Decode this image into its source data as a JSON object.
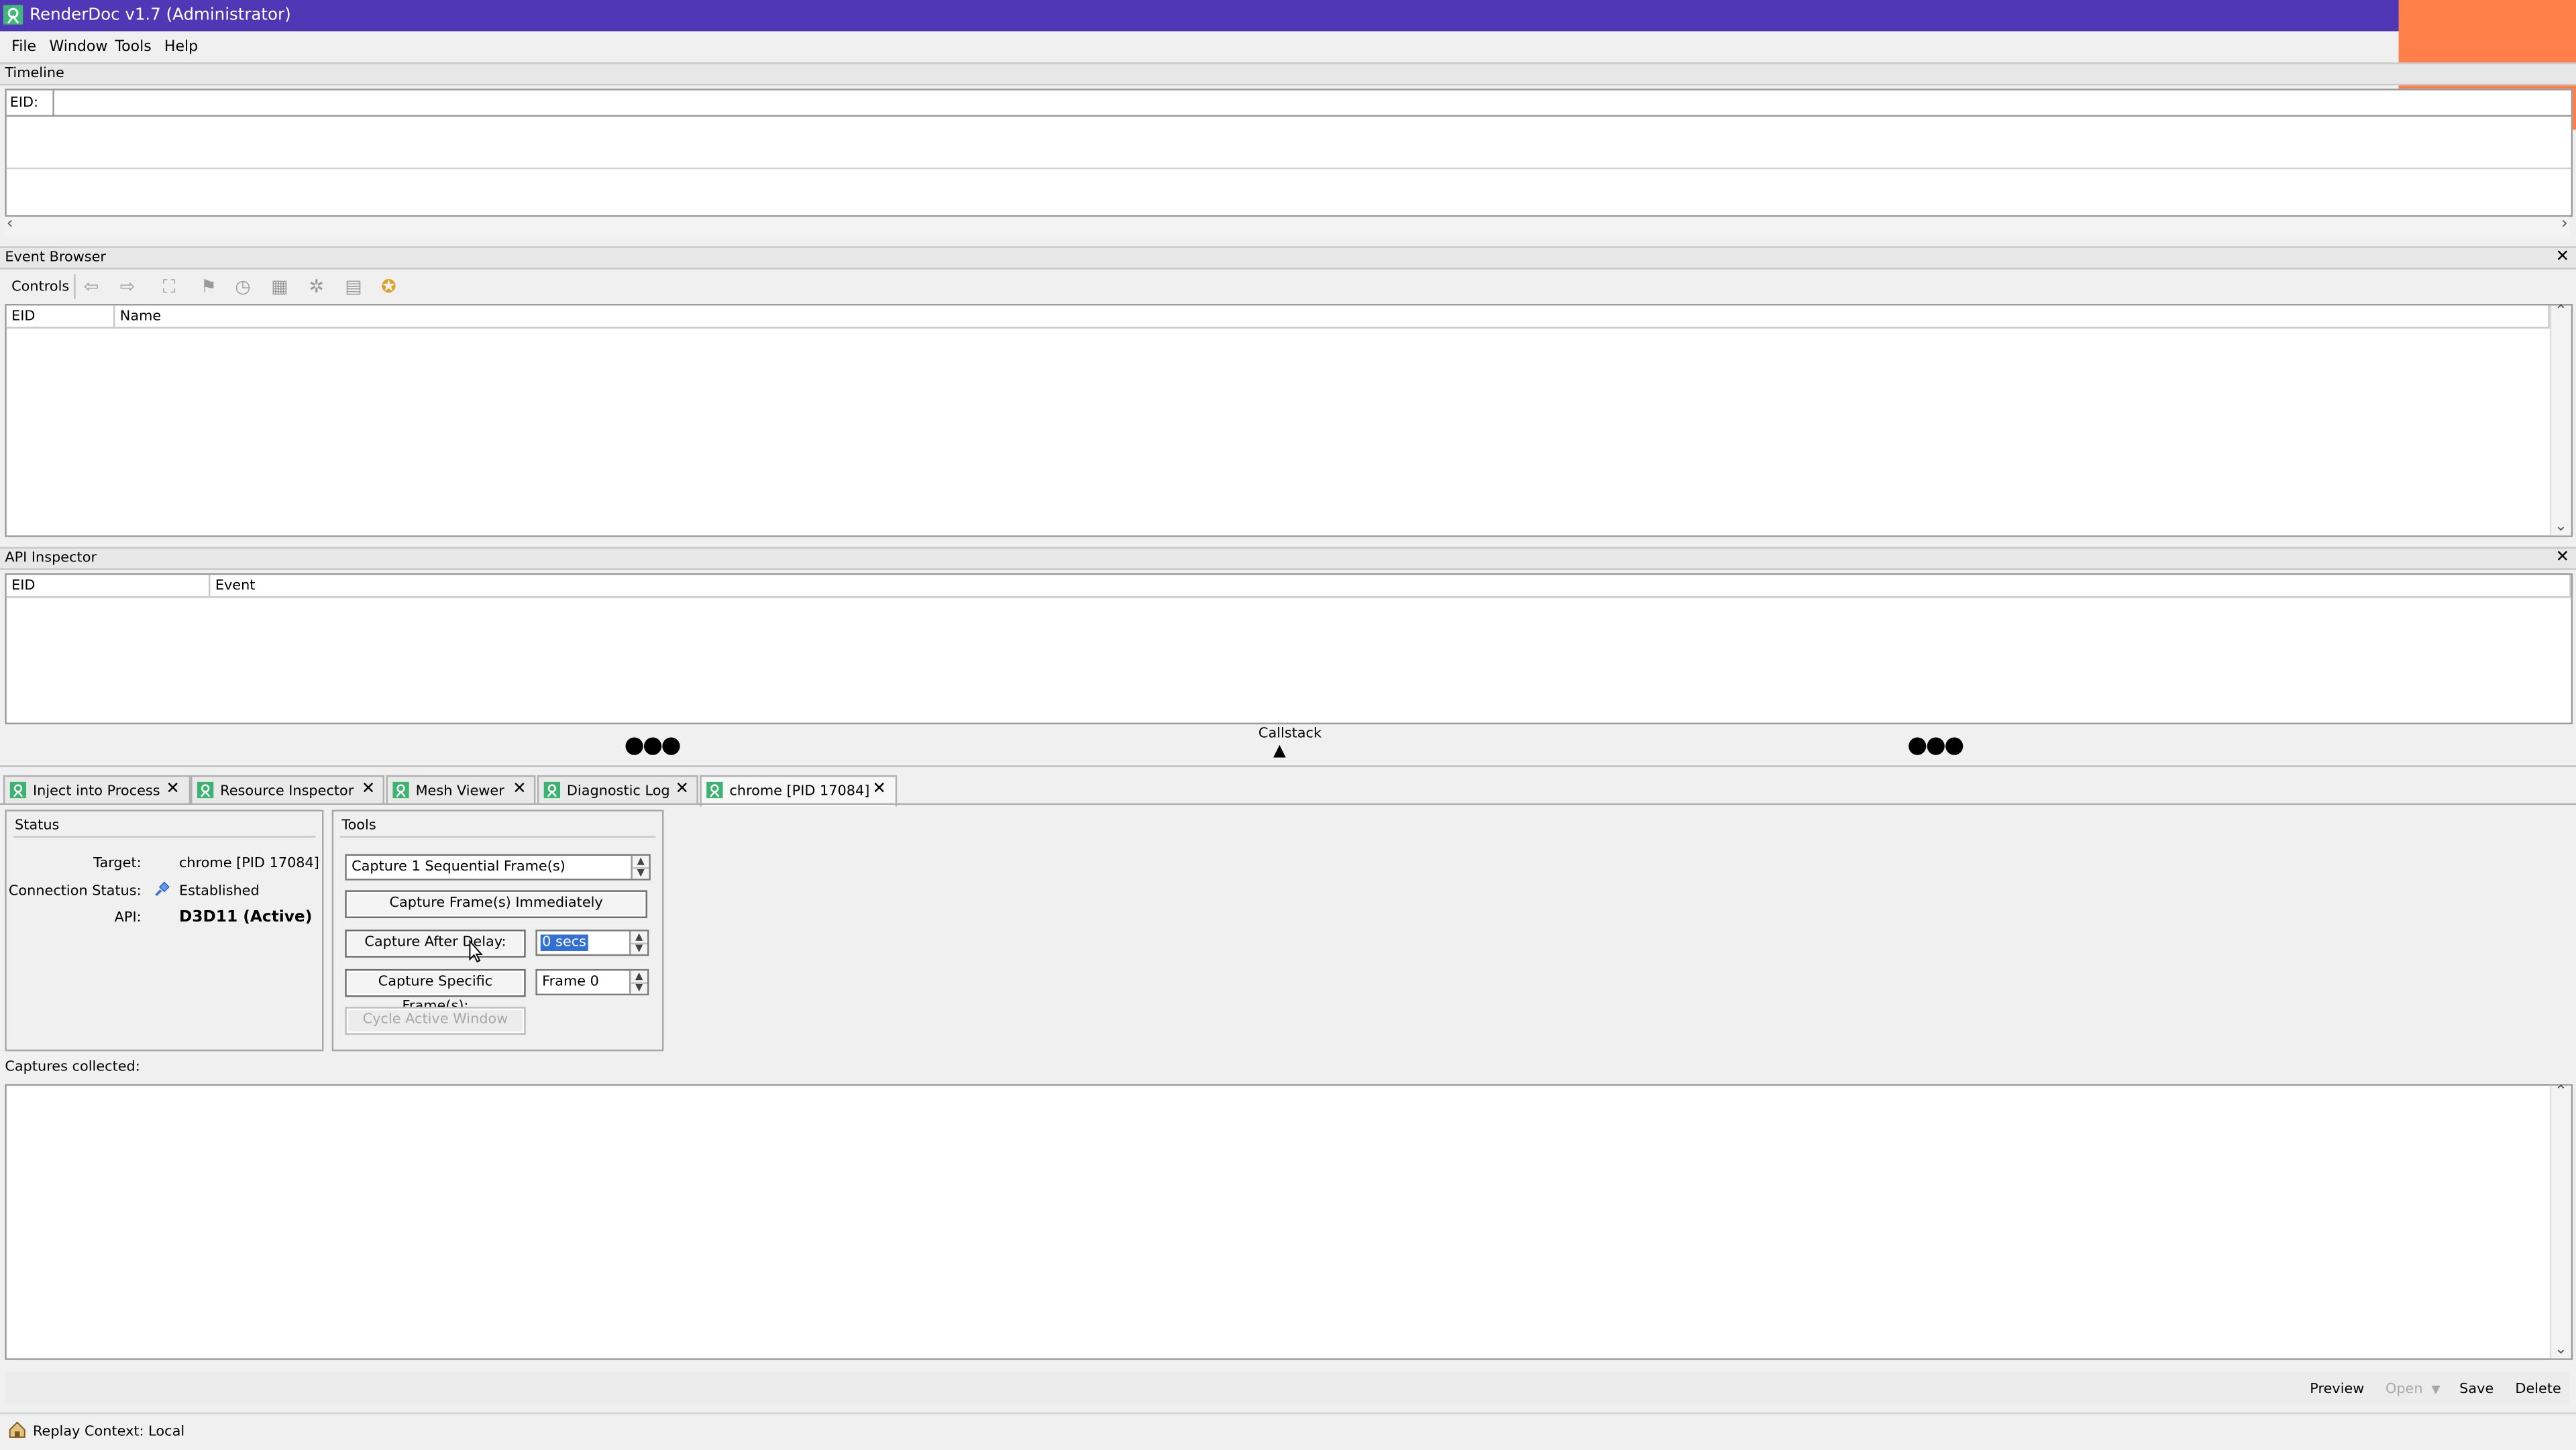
{
  "app": {
    "title": "RenderDoc v1.7 (Administrator)"
  },
  "menu": {
    "file": "File",
    "window": "Window",
    "tools": "Tools",
    "help": "Help"
  },
  "timeline": {
    "title": "Timeline",
    "eid_label": "EID:"
  },
  "event_browser": {
    "title": "Event Browser",
    "controls_label": "Controls",
    "col_eid": "EID",
    "col_name": "Name"
  },
  "api_inspector": {
    "title": "API Inspector",
    "col_eid": "EID",
    "col_event": "Event",
    "callstack": "Callstack"
  },
  "tabs": [
    {
      "label": "Inject into Process"
    },
    {
      "label": "Resource Inspector"
    },
    {
      "label": "Mesh Viewer"
    },
    {
      "label": "Diagnostic Log"
    },
    {
      "label": "chrome [PID 17084]"
    }
  ],
  "status": {
    "title": "Status",
    "target_label": "Target:",
    "target_value": "chrome [PID 17084]",
    "connection_label": "Connection Status:",
    "connection_value": "Established",
    "api_label": "API:",
    "api_value": "D3D11 (Active)"
  },
  "tools": {
    "title": "Tools",
    "sequential_value": "Capture 1 Sequential Frame(s)",
    "capture_immediately": "Capture Frame(s) Immediately",
    "capture_after_delay": "Capture After Delay:",
    "delay_value": "0 secs",
    "capture_specific": "Capture Specific Frame(s):",
    "frame_value": "Frame 0",
    "cycle_window": "Cycle Active Window"
  },
  "captures": {
    "label": "Captures collected:"
  },
  "actions": {
    "preview": "Preview",
    "open": "Open",
    "save": "Save",
    "delete": "Delete"
  },
  "statusbar": {
    "replay_context": "Replay Context: Local"
  },
  "colors": {
    "titlebar": "#4f37b5",
    "orange_block": "#ff7f4a",
    "tab_icon": "#3cb371"
  }
}
